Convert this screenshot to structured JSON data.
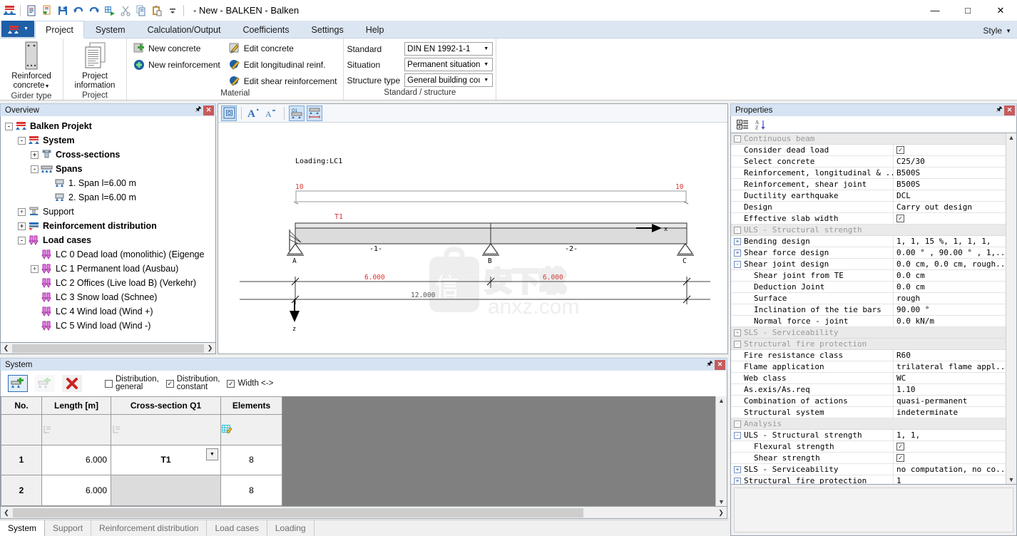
{
  "window": {
    "title": "- New - BALKEN - Balken",
    "minimize": "—",
    "maximize": "□",
    "close": "✕"
  },
  "quick_access": [
    {
      "name": "balken-logo-icon"
    },
    {
      "name": "new-document-icon"
    },
    {
      "name": "open-document-icon"
    },
    {
      "name": "save-icon"
    },
    {
      "name": "undo-icon"
    },
    {
      "name": "redo-icon"
    },
    {
      "name": "calculate-icon"
    },
    {
      "name": "cut-icon"
    },
    {
      "name": "copy-icon"
    },
    {
      "name": "paste-icon"
    },
    {
      "name": "customize-qat-icon"
    }
  ],
  "ribbon": {
    "tabs": [
      {
        "label": "Project",
        "active": true
      },
      {
        "label": "System",
        "active": false
      },
      {
        "label": "Calculation/Output",
        "active": false
      },
      {
        "label": "Coefficients",
        "active": false
      },
      {
        "label": "Settings",
        "active": false
      },
      {
        "label": "Help",
        "active": false
      }
    ],
    "style_menu": "Style",
    "groups": {
      "girder_type": {
        "label": "Girder type",
        "button": "Reinforced\nconcrete"
      },
      "project": {
        "label": "Project",
        "button": "Project\ninformation"
      },
      "material": {
        "label": "Material",
        "buttons": [
          {
            "label": "New concrete",
            "icon": "new-concrete-icon"
          },
          {
            "label": "New reinforcement",
            "icon": "new-reinforcement-icon"
          },
          {
            "label": "Edit concrete",
            "icon": "edit-concrete-icon"
          },
          {
            "label": "Edit longitudinal reinf.",
            "icon": "edit-longitudinal-icon"
          },
          {
            "label": "Edit shear reinforcement",
            "icon": "edit-shear-icon"
          }
        ]
      },
      "standard": {
        "label": "Standard / structure",
        "fields": [
          {
            "label": "Standard",
            "value": "DIN EN 1992-1-1"
          },
          {
            "label": "Situation",
            "value": "Permanent situation"
          },
          {
            "label": "Structure type",
            "value": "General building coı"
          }
        ]
      }
    }
  },
  "overview": {
    "title": "Overview",
    "tree": [
      {
        "label": "Balken Projekt",
        "depth": 0,
        "expander": "-",
        "bold": true,
        "icon": "project-icon"
      },
      {
        "label": "System",
        "depth": 1,
        "expander": "-",
        "bold": true,
        "icon": "system-icon"
      },
      {
        "label": "Cross-sections",
        "depth": 2,
        "expander": "+",
        "bold": true,
        "icon": "cross-section-icon"
      },
      {
        "label": "Spans",
        "depth": 2,
        "expander": "-",
        "bold": true,
        "icon": "spans-icon"
      },
      {
        "label": "1. Span  l=6.00 m",
        "depth": 3,
        "expander": "",
        "bold": false,
        "icon": "span-icon"
      },
      {
        "label": "2. Span  l=6.00 m",
        "depth": 3,
        "expander": "",
        "bold": false,
        "icon": "span-icon"
      },
      {
        "label": "Support",
        "depth": 1,
        "expander": "+",
        "bold": false,
        "icon": "support-icon"
      },
      {
        "label": "Reinforcement distribution",
        "depth": 1,
        "expander": "+",
        "bold": true,
        "icon": "reinforcement-icon"
      },
      {
        "label": "Load cases",
        "depth": 1,
        "expander": "-",
        "bold": true,
        "icon": "loadcases-icon"
      },
      {
        "label": "LC 0 Dead load (monolithic) (Eigenge",
        "depth": 2,
        "expander": "",
        "bold": false,
        "icon": "loadcase-icon"
      },
      {
        "label": "LC 1 Permanent load (Ausbau)",
        "depth": 2,
        "expander": "+",
        "bold": false,
        "icon": "loadcase-icon"
      },
      {
        "label": "LC 2 Offices (Live load B) (Verkehr)",
        "depth": 2,
        "expander": "",
        "bold": false,
        "icon": "loadcase-icon"
      },
      {
        "label": "LC 3 Snow load (Schnee)",
        "depth": 2,
        "expander": "",
        "bold": false,
        "icon": "loadcase-icon"
      },
      {
        "label": "LC 4 Wind load (Wind +)",
        "depth": 2,
        "expander": "",
        "bold": false,
        "icon": "loadcase-icon"
      },
      {
        "label": "LC 5 Wind load (Wind -)",
        "depth": 2,
        "expander": "",
        "bold": false,
        "icon": "loadcase-icon"
      }
    ]
  },
  "drawing": {
    "toolbar": [
      {
        "name": "zoom-fit-icon",
        "active": true
      },
      {
        "name": "increase-font-icon",
        "active": false
      },
      {
        "name": "decrease-font-icon",
        "active": false
      },
      {
        "name": "show-cross-section-icon",
        "active": true
      },
      {
        "name": "show-dimensions-icon",
        "active": true
      }
    ],
    "loading_label": "Loading:LC1",
    "load_value_left": "10",
    "load_value_right": "10",
    "cross_section_label": "T1",
    "supports": [
      "A",
      "B",
      "C"
    ],
    "span_labels": [
      "-1-",
      "-2-"
    ],
    "dim_span_1": "6.000",
    "dim_span_2": "6.000",
    "dim_total": "12.000",
    "axis_x": "x",
    "axis_z": "z",
    "watermark": "anxz.com",
    "colors": {
      "load_red": "#e03030",
      "beam_fill": "#dcdcdc",
      "dim_red": "#e03030"
    }
  },
  "properties": {
    "title": "Properties",
    "toolbar": [
      {
        "name": "categorized-icon"
      },
      {
        "name": "alphabetical-sort-icon"
      }
    ],
    "rows": [
      {
        "kind": "cat",
        "exp": "-",
        "name": "Continuous beam",
        "value": ""
      },
      {
        "kind": "row",
        "indent": 0,
        "exp": "",
        "name": "Consider dead load",
        "value": "",
        "checkbox": true
      },
      {
        "kind": "row",
        "indent": 0,
        "exp": "",
        "name": "Select concrete",
        "value": "C25/30"
      },
      {
        "kind": "row",
        "indent": 0,
        "exp": "",
        "name": "Reinforcement, longitudinal & ...",
        "value": "B500S"
      },
      {
        "kind": "row",
        "indent": 0,
        "exp": "",
        "name": "Reinforcement, shear joint",
        "value": "B500S"
      },
      {
        "kind": "row",
        "indent": 0,
        "exp": "",
        "name": "Ductility earthquake",
        "value": "DCL"
      },
      {
        "kind": "row",
        "indent": 0,
        "exp": "",
        "name": "Design",
        "value": "Carry out design"
      },
      {
        "kind": "row",
        "indent": 0,
        "exp": "",
        "name": "Effective slab width",
        "value": "",
        "checkbox": true
      },
      {
        "kind": "cat",
        "exp": "-",
        "name": "ULS - Structural strength",
        "value": ""
      },
      {
        "kind": "row",
        "indent": 0,
        "exp": "+",
        "name": "Bending design",
        "value": "1, 1, 15 %, 1, 1, 1,"
      },
      {
        "kind": "row",
        "indent": 0,
        "exp": "+",
        "name": "Shear force design",
        "value": "0.00 ° , 90.00 ° , 1,..."
      },
      {
        "kind": "row",
        "indent": 0,
        "exp": "-",
        "name": "Shear joint design",
        "value": "0.0 cm, 0.0 cm, rough..."
      },
      {
        "kind": "row",
        "indent": 1,
        "exp": "",
        "name": "Shear joint from TE",
        "value": "0.0 cm"
      },
      {
        "kind": "row",
        "indent": 1,
        "exp": "",
        "name": "Deduction Joint",
        "value": "0.0 cm"
      },
      {
        "kind": "row",
        "indent": 1,
        "exp": "",
        "name": "Surface",
        "value": "rough"
      },
      {
        "kind": "row",
        "indent": 1,
        "exp": "",
        "name": "Inclination of the tie bars",
        "value": "90.00 °"
      },
      {
        "kind": "row",
        "indent": 1,
        "exp": "",
        "name": "Normal force - joint",
        "value": "0.0 kN/m"
      },
      {
        "kind": "cat",
        "exp": "+",
        "name": "SLS - Serviceability",
        "value": ""
      },
      {
        "kind": "cat",
        "exp": "-",
        "name": "Structural fire protection",
        "value": ""
      },
      {
        "kind": "row",
        "indent": 0,
        "exp": "",
        "name": "Fire resistance class",
        "value": "R60"
      },
      {
        "kind": "row",
        "indent": 0,
        "exp": "",
        "name": "Flame application",
        "value": "trilateral flame appl..."
      },
      {
        "kind": "row",
        "indent": 0,
        "exp": "",
        "name": "Web class",
        "value": "WC"
      },
      {
        "kind": "row",
        "indent": 0,
        "exp": "",
        "name": "As.exis/As.req",
        "value": "1.10"
      },
      {
        "kind": "row",
        "indent": 0,
        "exp": "",
        "name": "Combination of actions",
        "value": "quasi-permanent"
      },
      {
        "kind": "row",
        "indent": 0,
        "exp": "",
        "name": "Structural system",
        "value": "indeterminate"
      },
      {
        "kind": "cat",
        "exp": "-",
        "name": "Analysis",
        "value": ""
      },
      {
        "kind": "row",
        "indent": 0,
        "exp": "-",
        "name": "ULS - Structural strength",
        "value": "1, 1,"
      },
      {
        "kind": "row",
        "indent": 1,
        "exp": "",
        "name": "Flexural strength",
        "value": "",
        "checkbox": true
      },
      {
        "kind": "row",
        "indent": 1,
        "exp": "",
        "name": "Shear strength",
        "value": "",
        "checkbox": true
      },
      {
        "kind": "row",
        "indent": 0,
        "exp": "+",
        "name": "SLS - Serviceability",
        "value": "no computation, no co..."
      },
      {
        "kind": "row",
        "indent": 0,
        "exp": "+",
        "name": "Structural fire protection",
        "value": "1"
      }
    ]
  },
  "system_panel": {
    "title": "System",
    "toolbar": {
      "add_span_button": "add-span-icon",
      "insert_span_button": "insert-span-icon",
      "delete_span_button": "delete-span-icon",
      "checkboxes": [
        {
          "label_line1": "Distribution,",
          "label_line2": "general",
          "checked": false
        },
        {
          "label_line1": "Distribution,",
          "label_line2": "constant",
          "checked": true
        },
        {
          "label_line1": "Width <->",
          "label_line2": "",
          "checked": true
        }
      ]
    },
    "table": {
      "headers": [
        "No.",
        "Length [m]",
        "Cross-section Q1",
        "Elements"
      ],
      "filter_row": [
        "",
        "filter-icon",
        "filter-icon",
        "grid-edit-icon"
      ],
      "rows": [
        {
          "no": "1",
          "length": "6.000",
          "cross_section": "T1",
          "elements": "8",
          "has_dropdown": true
        },
        {
          "no": "2",
          "length": "6.000",
          "cross_section": "",
          "elements": "8",
          "has_dropdown": false
        }
      ]
    }
  },
  "bottom_tabs": [
    {
      "label": "System",
      "active": true
    },
    {
      "label": "Support",
      "active": false
    },
    {
      "label": "Reinforcement distribution",
      "active": false
    },
    {
      "label": "Load cases",
      "active": false
    },
    {
      "label": "Loading",
      "active": false
    }
  ]
}
